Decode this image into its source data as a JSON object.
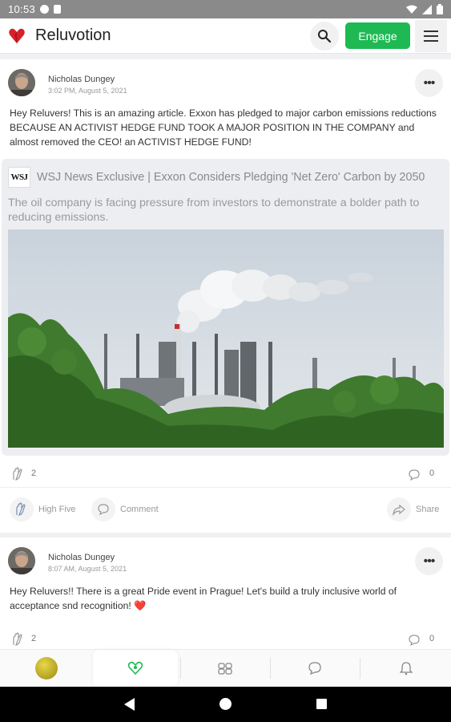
{
  "status_bar": {
    "time": "10:53"
  },
  "app": {
    "brand": "Reluvotion",
    "engage_label": "Engage",
    "accent": "#1fb954",
    "logo_color": "#d6202a"
  },
  "posts": [
    {
      "author": "Nicholas  Dungey",
      "time": "3:02 PM, August 5, 2021",
      "text": "Hey Reluvers! This is an amazing article. Exxon has pledged to major carbon emissions reductions BECAUSE AN ACTIVIST HEDGE FUND TOOK A MAJOR POSITION IN THE COMPANY and almost removed the CEO!  an ACTIVIST HEDGE FUND!",
      "link": {
        "source_logo": "WSJ",
        "title": "WSJ News Exclusive | Exxon Considers Pledging 'Net Zero' Carbon by 2050",
        "description": "The oil company is facing pressure from investors to demonstrate a bolder path to reducing emissions."
      },
      "high_five_count": "2",
      "comment_count": "0",
      "actions": {
        "high_five": "High Five",
        "comment": "Comment",
        "share": "Share"
      }
    },
    {
      "author": "Nicholas  Dungey",
      "time": "8:07 AM, August 5, 2021",
      "text": "Hey Reluvers!! There is a great Pride event in Prague! Let's build a truly inclusive world of acceptance snd recognition! ❤️",
      "high_five_count": "2",
      "comment_count": "0"
    }
  ],
  "bottom_nav": {
    "items": [
      "profile-avatar",
      "home-heart-icon",
      "groups-icon",
      "chat-bubble-icon",
      "bell-icon"
    ]
  }
}
